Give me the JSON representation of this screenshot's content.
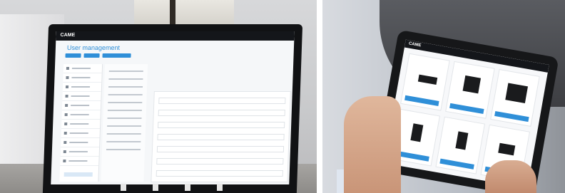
{
  "panels": [
    {
      "id": "laptop",
      "kind": "photo",
      "device": "laptop",
      "app": "CAME",
      "screen_title": "User management"
    },
    {
      "id": "tablet",
      "kind": "photo",
      "device": "tablet",
      "app": "CAME"
    }
  ],
  "colors": {
    "accent": "#2f8fd8",
    "device_bezel": "#111214",
    "app_topbar": "#14161a"
  }
}
